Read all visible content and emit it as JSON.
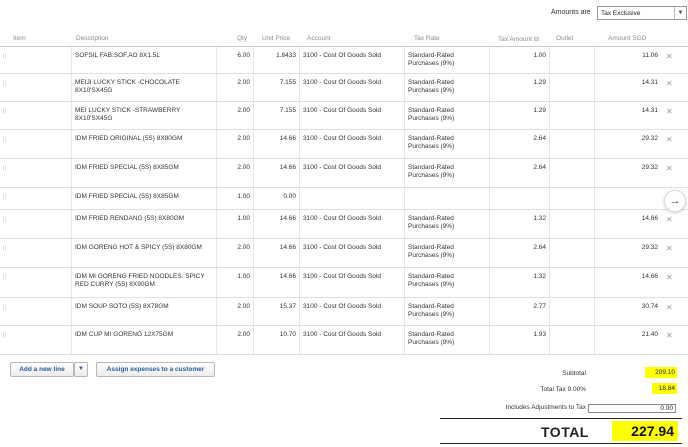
{
  "amounts_bar": {
    "label": "Amounts are",
    "selected": "Tax Exclusive"
  },
  "columns": {
    "item": "Item",
    "description": "Description",
    "qty": "Qty",
    "unit_price": "Unit Price",
    "account": "Account",
    "tax_rate": "Tax Rate",
    "tax_amount": "Tax Amount",
    "outlet": "Outlet",
    "amount": "Amount SGD"
  },
  "rows": [
    {
      "description": "SOFSIL FAB.SOF.AO 8X1.5L",
      "qty": "6.00",
      "unit_price": "1.8433",
      "account": "3100 - Cost Of Goods Sold",
      "tax_rate": "Standard-Rated Purchases (9%)",
      "tax_amount": "1.00",
      "amount": "11.06"
    },
    {
      "description": "MEIJI LUCKY STICK -CHOCOLATE 8X10'SX45G",
      "qty": "2.00",
      "unit_price": "7.155",
      "account": "3100 - Cost Of Goods Sold",
      "tax_rate": "Standard-Rated Purchases (9%)",
      "tax_amount": "1.29",
      "amount": "14.31"
    },
    {
      "description": "MEI LUCKY STICK -STRAWBERRY 8X10'SX45G",
      "qty": "2.00",
      "unit_price": "7.155",
      "account": "3100 - Cost Of Goods Sold",
      "tax_rate": "Standard-Rated Purchases (9%)",
      "tax_amount": "1.29",
      "amount": "14.31"
    },
    {
      "description": "IDM FRIED ORIGINAL (5S) 8X80GM",
      "qty": "2.00",
      "unit_price": "14.66",
      "account": "3100 - Cost Of Goods Sold",
      "tax_rate": "Standard-Rated Purchases (9%)",
      "tax_amount": "2.64",
      "amount": "29.32"
    },
    {
      "description": "IDM FRIED SPECIAL (5S) 8X85GM",
      "qty": "2.00",
      "unit_price": "14.66",
      "account": "3100 - Cost Of Goods Sold",
      "tax_rate": "Standard-Rated Purchases (9%)",
      "tax_amount": "2.64",
      "amount": "29.32"
    },
    {
      "description": "IDM FRIED SPECIAL (5S) 8X85GM",
      "qty": "1.00",
      "unit_price": "0.00",
      "account": "",
      "tax_rate": "",
      "tax_amount": "",
      "amount": ""
    },
    {
      "description": "IDM FRIED RENDANG (5S) 8X80GM",
      "qty": "1.00",
      "unit_price": "14.66",
      "account": "3100 - Cost Of Goods Sold",
      "tax_rate": "Standard-Rated Purchases (9%)",
      "tax_amount": "1.32",
      "amount": "14.66"
    },
    {
      "description": "IDM GORENG HOT & SPICY (5S) 8X80GM",
      "qty": "2.00",
      "unit_price": "14.66",
      "account": "3100 - Cost Of Goods Sold",
      "tax_rate": "Standard-Rated Purchases (9%)",
      "tax_amount": "2.64",
      "amount": "29.32"
    },
    {
      "description": "IDM MI GORENG FRIED NOODLES. SPICY RED CURRY (5S) 8X90GM",
      "qty": "1.00",
      "unit_price": "14.66",
      "account": "3100 - Cost Of Goods Sold",
      "tax_rate": "Standard-Rated Purchases (9%)",
      "tax_amount": "1.32",
      "amount": "14.66"
    },
    {
      "description": "IDM SOUP SOTO (5S) 8X78GM",
      "qty": "2.00",
      "unit_price": "15.37",
      "account": "3100 - Cost Of Goods Sold",
      "tax_rate": "Standard-Rated Purchases (9%)",
      "tax_amount": "2.77",
      "amount": "30.74"
    },
    {
      "description": "IDM CUP MI GORENG 12X75GM",
      "qty": "2.00",
      "unit_price": "10.70",
      "account": "3100 - Cost Of Goods Sold",
      "tax_rate": "Standard-Rated Purchases (9%)",
      "tax_amount": "1.93",
      "amount": "21.40"
    }
  ],
  "buttons": {
    "add_line": "Add a new line",
    "assign": "Assign expenses to a customer"
  },
  "totals": {
    "subtotal_label": "Subtotal",
    "subtotal": "209.10",
    "tax_label": "Total Tax 9.00%",
    "tax": "18.84",
    "adjust_label": "Includes Adjustments to Tax",
    "adjust": "0.00",
    "total_label": "TOTAL",
    "total": "227.94"
  },
  "colors": {
    "highlight": "#ffff00",
    "link_blue": "#2a5c9a"
  }
}
